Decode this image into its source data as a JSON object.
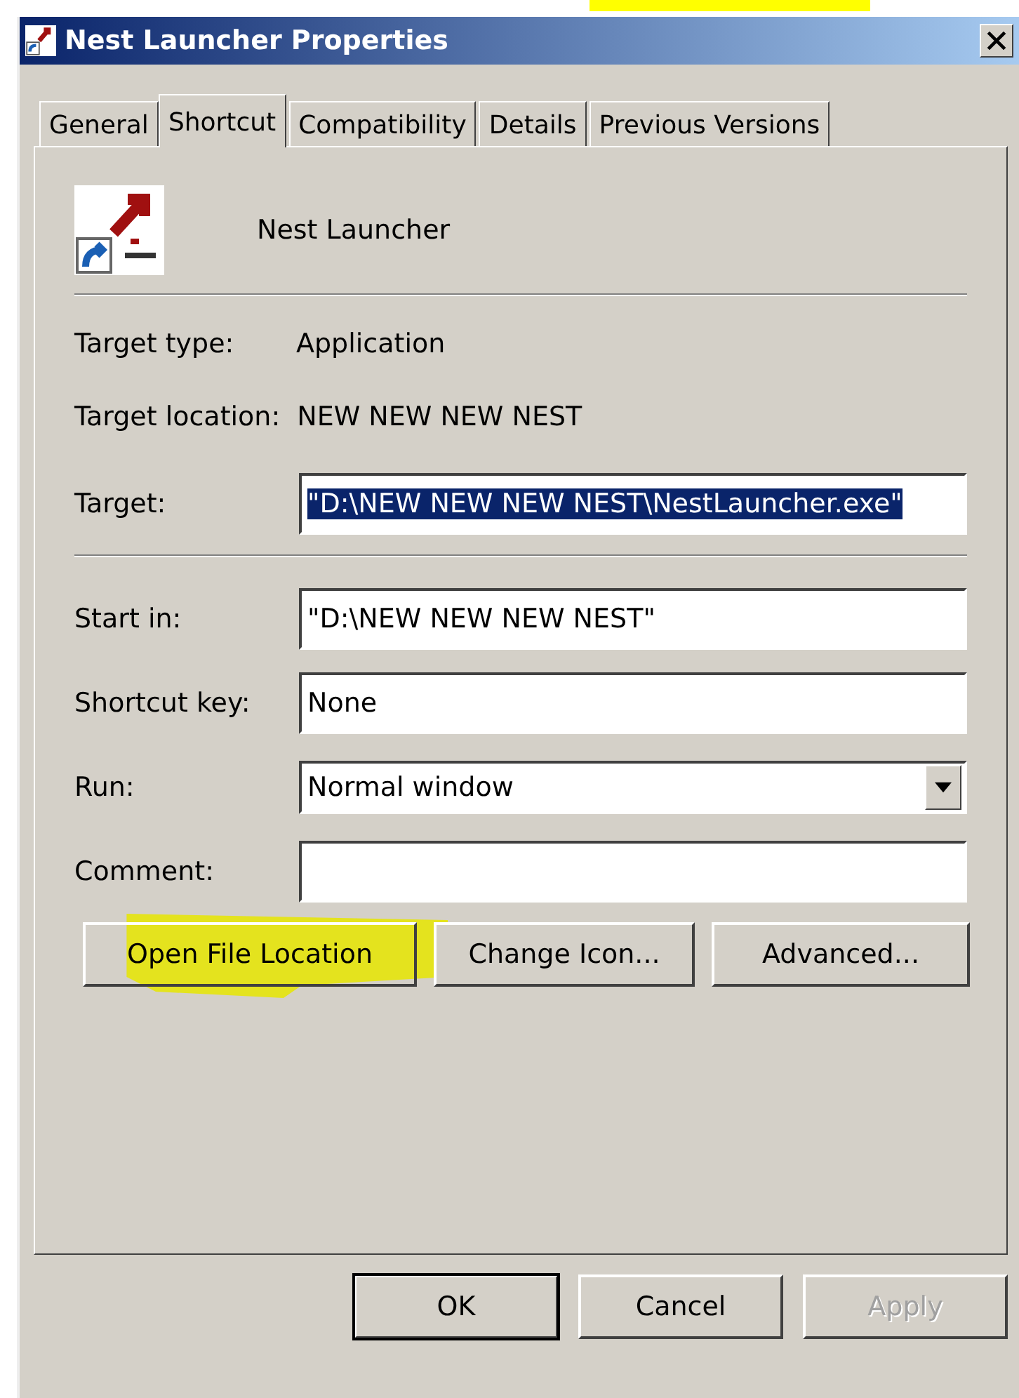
{
  "window": {
    "title": "Nest Launcher Properties"
  },
  "tabs": [
    {
      "label": "General",
      "selected": false
    },
    {
      "label": "Shortcut",
      "selected": true
    },
    {
      "label": "Compatibility",
      "selected": false
    },
    {
      "label": "Details",
      "selected": false
    },
    {
      "label": "Previous Versions",
      "selected": false
    }
  ],
  "shortcut_name": "Nest Launcher",
  "fields": [
    {
      "kind": "separator"
    },
    {
      "kind": "text",
      "label": "Target type:",
      "value": "Application"
    },
    {
      "kind": "text",
      "label": "Target location:",
      "value": "NEW NEW NEW NEST"
    },
    {
      "kind": "input",
      "label": "Target:",
      "value": "\"D:\\NEW NEW NEW NEST\\NestLauncher.exe\"",
      "selected": true
    },
    {
      "kind": "separator"
    },
    {
      "kind": "input",
      "label": "Start in:",
      "value": "\"D:\\NEW NEW NEW NEST\"",
      "selected": false
    },
    {
      "kind": "input",
      "label": "Shortcut key:",
      "value": "None",
      "selected": false
    },
    {
      "kind": "dropdown",
      "label": "Run:",
      "value": "Normal window"
    },
    {
      "kind": "input",
      "label": "Comment:"
    }
  ],
  "action_buttons": [
    {
      "label": "Open File Location",
      "highlighted": true
    },
    {
      "label": "Change Icon...",
      "highlighted": false
    },
    {
      "label": "Advanced...",
      "highlighted": false
    }
  ],
  "dialog_buttons": [
    {
      "label": "OK",
      "default": true,
      "disabled": false
    },
    {
      "label": "Cancel",
      "default": false,
      "disabled": false
    },
    {
      "label": "Apply",
      "default": false,
      "disabled": true
    }
  ]
}
